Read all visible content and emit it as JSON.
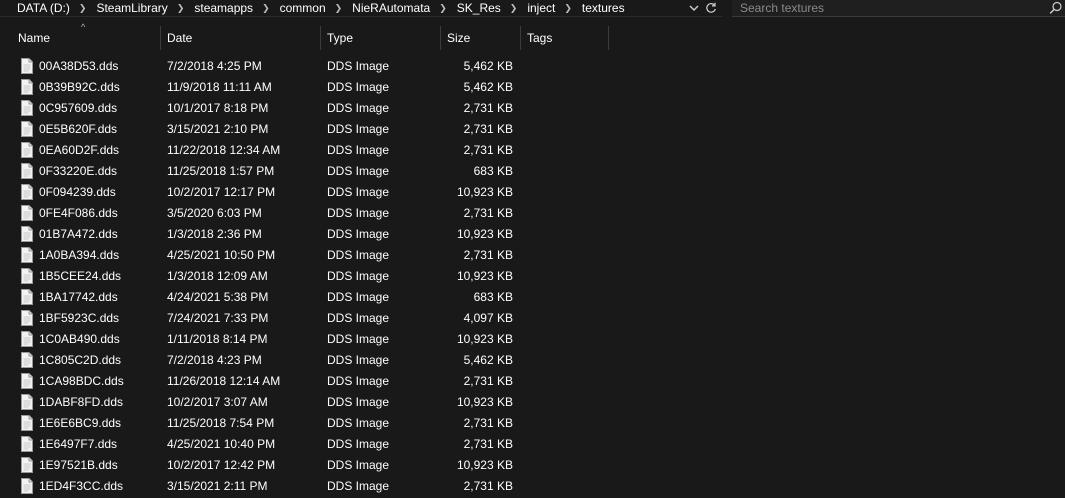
{
  "address_bar": {
    "crumbs": [
      "DATA (D:)",
      "SteamLibrary",
      "steamapps",
      "common",
      "NieRAutomata",
      "SK_Res",
      "inject",
      "textures"
    ]
  },
  "search": {
    "placeholder": "Search textures"
  },
  "columns": {
    "name": "Name",
    "date": "Date",
    "type": "Type",
    "size": "Size",
    "tags": "Tags"
  },
  "files": [
    {
      "name": "00A38D53.dds",
      "date": "7/2/2018 4:25 PM",
      "type": "DDS Image",
      "size": "5,462 KB"
    },
    {
      "name": "0B39B92C.dds",
      "date": "11/9/2018 11:11 AM",
      "type": "DDS Image",
      "size": "5,462 KB"
    },
    {
      "name": "0C957609.dds",
      "date": "10/1/2017 8:18 PM",
      "type": "DDS Image",
      "size": "2,731 KB"
    },
    {
      "name": "0E5B620F.dds",
      "date": "3/15/2021 2:10 PM",
      "type": "DDS Image",
      "size": "2,731 KB"
    },
    {
      "name": "0EA60D2F.dds",
      "date": "11/22/2018 12:34 AM",
      "type": "DDS Image",
      "size": "2,731 KB"
    },
    {
      "name": "0F33220E.dds",
      "date": "11/25/2018 1:57 PM",
      "type": "DDS Image",
      "size": "683 KB"
    },
    {
      "name": "0F094239.dds",
      "date": "10/2/2017 12:17 PM",
      "type": "DDS Image",
      "size": "10,923 KB"
    },
    {
      "name": "0FE4F086.dds",
      "date": "3/5/2020 6:03 PM",
      "type": "DDS Image",
      "size": "2,731 KB"
    },
    {
      "name": "01B7A472.dds",
      "date": "1/3/2018 2:36 PM",
      "type": "DDS Image",
      "size": "10,923 KB"
    },
    {
      "name": "1A0BA394.dds",
      "date": "4/25/2021 10:50 PM",
      "type": "DDS Image",
      "size": "2,731 KB"
    },
    {
      "name": "1B5CEE24.dds",
      "date": "1/3/2018 12:09 AM",
      "type": "DDS Image",
      "size": "10,923 KB"
    },
    {
      "name": "1BA17742.dds",
      "date": "4/24/2021 5:38 PM",
      "type": "DDS Image",
      "size": "683 KB"
    },
    {
      "name": "1BF5923C.dds",
      "date": "7/24/2021 7:33 PM",
      "type": "DDS Image",
      "size": "4,097 KB"
    },
    {
      "name": "1C0AB490.dds",
      "date": "1/11/2018 8:14 PM",
      "type": "DDS Image",
      "size": "10,923 KB"
    },
    {
      "name": "1C805C2D.dds",
      "date": "7/2/2018 4:23 PM",
      "type": "DDS Image",
      "size": "5,462 KB"
    },
    {
      "name": "1CA98BDC.dds",
      "date": "11/26/2018 12:14 AM",
      "type": "DDS Image",
      "size": "2,731 KB"
    },
    {
      "name": "1DABF8FD.dds",
      "date": "10/2/2017 3:07 AM",
      "type": "DDS Image",
      "size": "10,923 KB"
    },
    {
      "name": "1E6E6BC9.dds",
      "date": "11/25/2018 7:54 PM",
      "type": "DDS Image",
      "size": "2,731 KB"
    },
    {
      "name": "1E6497F7.dds",
      "date": "4/25/2021 10:40 PM",
      "type": "DDS Image",
      "size": "2,731 KB"
    },
    {
      "name": "1E97521B.dds",
      "date": "10/2/2017 12:42 PM",
      "type": "DDS Image",
      "size": "10,923 KB"
    },
    {
      "name": "1ED4F3CC.dds",
      "date": "3/15/2021 2:11 PM",
      "type": "DDS Image",
      "size": "2,731 KB"
    }
  ],
  "icons": {
    "file": "document-icon",
    "search": "search-icon",
    "dropdown": "chevron-down-icon",
    "refresh": "refresh-icon",
    "breadcrumb_separator": "chevron-right-icon",
    "sort": "sort-ascending-icon"
  },
  "colors": {
    "background": "#191919",
    "text": "#ffffff",
    "muted_text": "#8a8a8a",
    "divider": "#3b3b3b"
  }
}
